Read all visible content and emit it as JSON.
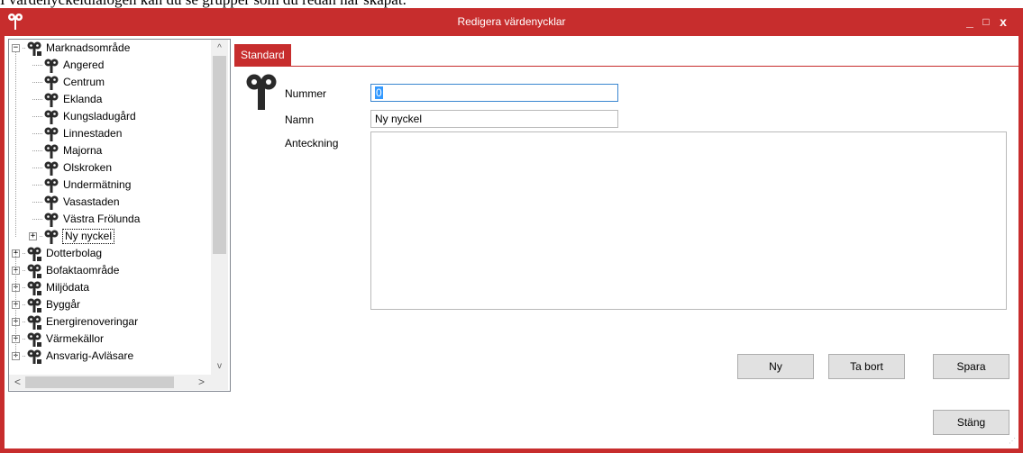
{
  "caption": "I värdenyckeldialogen kan du se grupper som du redan har skapat.",
  "window": {
    "title": "Redigera värdenycklar",
    "app_icon": "key-icon",
    "accent_color": "#c72d2d",
    "controls": {
      "minimize": "_",
      "maximize": "□",
      "close": "x"
    }
  },
  "tree": {
    "items": [
      {
        "label": "Marknadsområde",
        "level": 0,
        "expander": "−",
        "icon": "key-group-icon"
      },
      {
        "label": "Angered",
        "level": 1,
        "icon": "key-icon"
      },
      {
        "label": "Centrum",
        "level": 1,
        "icon": "key-icon"
      },
      {
        "label": "Eklanda",
        "level": 1,
        "icon": "key-icon"
      },
      {
        "label": "Kungsladugård",
        "level": 1,
        "icon": "key-icon"
      },
      {
        "label": "Linnestaden",
        "level": 1,
        "icon": "key-icon"
      },
      {
        "label": "Majorna",
        "level": 1,
        "icon": "key-icon"
      },
      {
        "label": "Olskroken",
        "level": 1,
        "icon": "key-icon"
      },
      {
        "label": "Undermätning",
        "level": 1,
        "icon": "key-icon"
      },
      {
        "label": "Vasastaden",
        "level": 1,
        "icon": "key-icon"
      },
      {
        "label": "Västra Frölunda",
        "level": 1,
        "icon": "key-icon"
      },
      {
        "label": "Ny nyckel",
        "level": 1,
        "expander": "+",
        "icon": "key-icon",
        "selected": true
      },
      {
        "label": "Dotterbolag",
        "level": 0,
        "expander": "+",
        "icon": "key-group-icon"
      },
      {
        "label": "Bofaktaområde",
        "level": 0,
        "expander": "+",
        "icon": "key-group-icon"
      },
      {
        "label": "Miljödata",
        "level": 0,
        "expander": "+",
        "icon": "key-group-icon"
      },
      {
        "label": "Byggår",
        "level": 0,
        "expander": "+",
        "icon": "key-group-icon"
      },
      {
        "label": "Energirenoveringar",
        "level": 0,
        "expander": "+",
        "icon": "key-group-icon"
      },
      {
        "label": "Värmekällor",
        "level": 0,
        "expander": "+",
        "icon": "key-group-icon"
      },
      {
        "label": "Ansvarig-Avläsare",
        "level": 0,
        "expander": "+",
        "icon": "key-group-icon"
      }
    ],
    "scroll": {
      "up": "^",
      "down": "v",
      "left": "<",
      "right": ">"
    }
  },
  "tabs": [
    {
      "label": "Standard",
      "active": true
    }
  ],
  "form": {
    "number_label": "Nummer",
    "number_value": "0",
    "name_label": "Namn",
    "name_value": "Ny nyckel",
    "note_label": "Anteckning",
    "note_value": ""
  },
  "buttons": {
    "new": "Ny",
    "delete": "Ta bort",
    "save": "Spara",
    "close": "Stäng"
  }
}
